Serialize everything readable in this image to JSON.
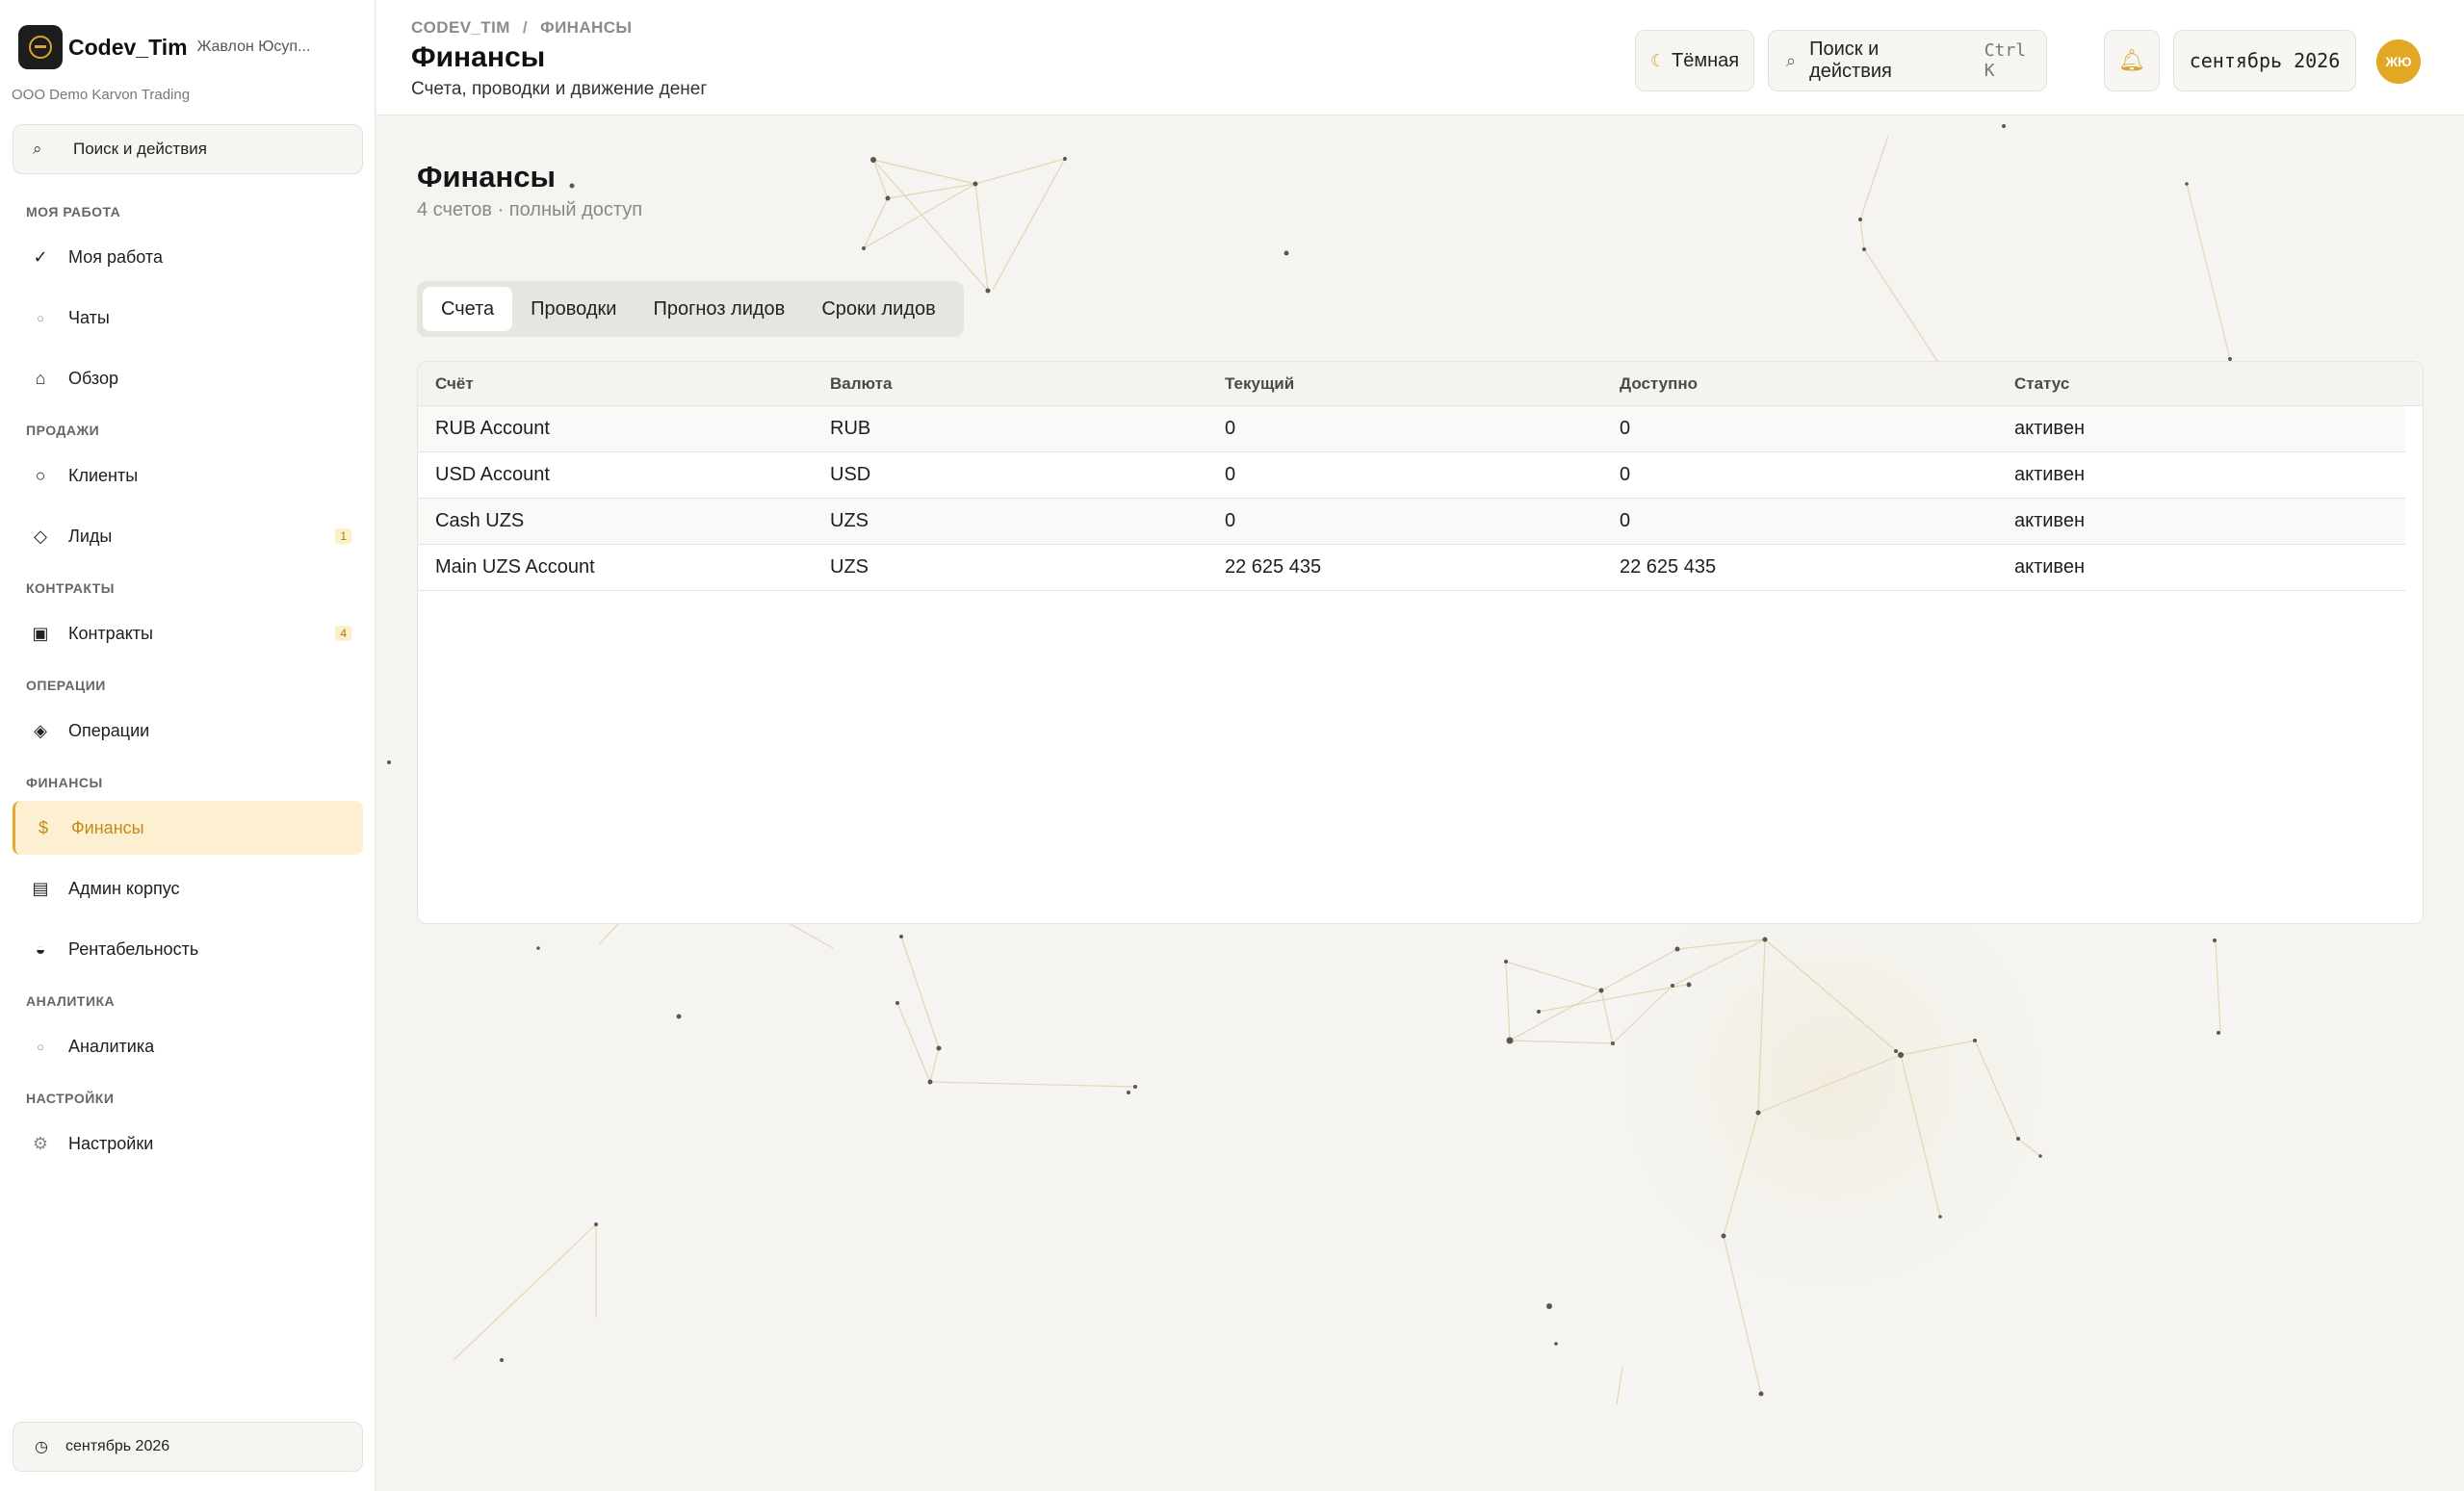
{
  "sidebar": {
    "brand_name": "Codev_Tim",
    "brand_user": "Жавлон Юсуп...",
    "company": "OOO Demo Karvon Trading",
    "search_label": "Поиск и действия",
    "sections": {
      "my_work": "МОЯ РАБОТА",
      "sales": "ПРОДАЖИ",
      "contracts": "КОНТРАКТЫ",
      "operations": "ОПЕРАЦИИ",
      "finance": "ФИНАНСЫ",
      "analytics": "АНАЛИТИКА",
      "settings": "НАСТРОЙКИ"
    },
    "items": {
      "my_work": "Моя работа",
      "chats": "Чаты",
      "overview": "Обзор",
      "clients": "Клиенты",
      "leads": "Лиды",
      "leads_badge": "1",
      "contracts": "Контракты",
      "contracts_badge": "4",
      "operations": "Операции",
      "finance": "Финансы",
      "admin": "Админ корпус",
      "profitability": "Рентабельность",
      "analytics": "Аналитика",
      "settings": "Настройки"
    },
    "footer_period": "сентябрь 2026"
  },
  "header": {
    "crumb_root": "CODEV_TIM",
    "crumb_sep": "/",
    "crumb_current": "ФИНАНСЫ",
    "title": "Финансы",
    "subtitle": "Счета, проводки и движение денег",
    "theme_label": "Тёмная",
    "search_label": "Поиск и действия",
    "search_shortcut": "Ctrl K",
    "period": "сентябрь 2026",
    "avatar_initials": "ЖЮ"
  },
  "main": {
    "title": "Финансы",
    "meta": "4 счетов · полный доступ",
    "tabs": [
      "Счета",
      "Проводки",
      "Прогноз лидов",
      "Сроки лидов"
    ],
    "table": {
      "columns": [
        "Счёт",
        "Валюта",
        "Текущий",
        "Доступно",
        "Статус"
      ],
      "rows": [
        [
          "RUB Account",
          "RUB",
          "0",
          "0",
          "активен"
        ],
        [
          "USD Account",
          "USD",
          "0",
          "0",
          "активен"
        ],
        [
          "Cash UZS",
          "UZS",
          "0",
          "0",
          "активен"
        ],
        [
          "Main UZS Account",
          "UZS",
          "22 625 435",
          "22 625 435",
          "активен"
        ]
      ]
    }
  },
  "colors": {
    "accent": "#e1ac30",
    "active_bg": "#fdf0d2",
    "page_bg": "#f5f4f1"
  },
  "icons": {
    "search": "search-icon",
    "check": "check-icon",
    "chat": "chat-icon",
    "home": "home-icon",
    "client": "circle-icon",
    "lead": "diamond-icon",
    "contract": "square-icon",
    "operation": "diamond-dot-icon",
    "finance": "dollar-icon",
    "admin": "table-icon",
    "profit": "half-circle-icon",
    "analytics": "small-circle-icon",
    "settings": "gear-icon",
    "clock": "clock-icon",
    "moon": "moon-icon",
    "bell": "bell-icon"
  }
}
